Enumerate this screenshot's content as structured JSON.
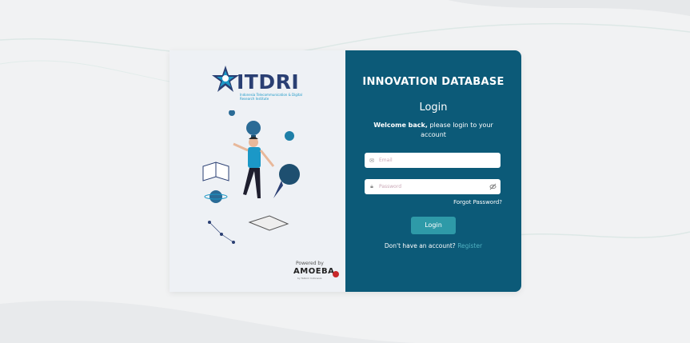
{
  "brand": {
    "logo_text": "ITDRI",
    "logo_subtitle": "Indonesia Telecommunication & Digital Research Institute",
    "powered_by": "Powered by",
    "amoeba": "AMOEBA",
    "amoeba_sub": "by Telkom Indonesia"
  },
  "login": {
    "heading": "INNOVATION DATABASE",
    "title": "Login",
    "welcome_bold": "Welcome back,",
    "welcome_rest": " please login to your account",
    "email_placeholder": "Email",
    "password_placeholder": "Password",
    "forgot": "Forgot Password?",
    "button": "Login",
    "no_account": "Don't have an account?",
    "register": "Register"
  },
  "colors": {
    "panel": "#0c5a78",
    "button": "#2e9aa8",
    "link": "#4fb1c2"
  }
}
